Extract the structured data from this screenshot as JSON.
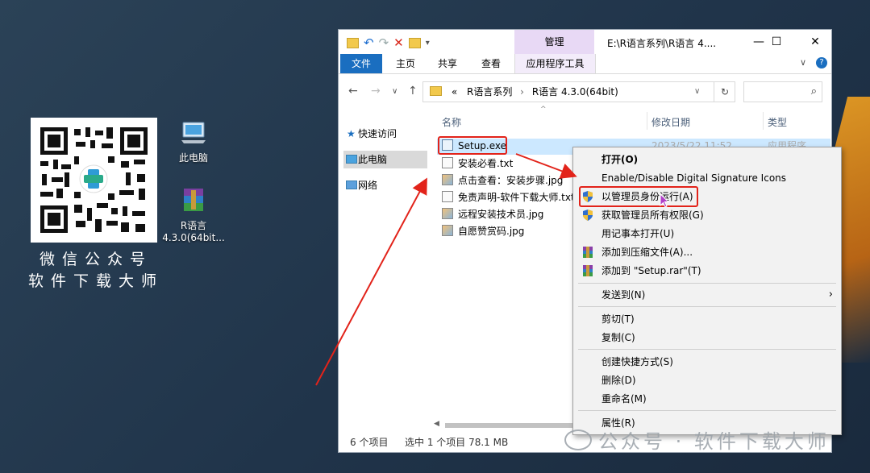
{
  "desktop": {
    "qr_caption_line1": "微信公众号",
    "qr_caption_line2": "软件下载大师",
    "icons": [
      {
        "label": "此电脑",
        "icon": "computer-icon"
      },
      {
        "label": "R语言\n4.3.0(64bit...",
        "icon": "winrar-archive-icon"
      }
    ]
  },
  "window": {
    "title": "E:\\R语言系列\\R语言 4....",
    "manage_tab": "管理",
    "ribbon_tabs": [
      "文件",
      "主页",
      "共享",
      "查看",
      "应用程序工具"
    ],
    "breadcrumb": {
      "prefix": "«",
      "parts": [
        "R语言系列",
        "R语言 4.3.0(64bit)"
      ]
    },
    "columns": [
      "名称",
      "修改日期",
      "类型"
    ],
    "nav_items": [
      "快速访问",
      "此电脑",
      "网络"
    ],
    "files": [
      {
        "name": "Setup.exe",
        "date": "2023/5/22 11:52",
        "type": "应用程序",
        "icon": "exe-icon"
      },
      {
        "name": "安装必看.txt",
        "icon": "txt-icon"
      },
      {
        "name": "点击查看：安装步骤.jpg",
        "icon": "jpg-icon"
      },
      {
        "name": "免责声明-软件下载大师.txt",
        "icon": "txt-icon"
      },
      {
        "name": "远程安装技术员.jpg",
        "icon": "jpg-icon"
      },
      {
        "name": "自愿赞赏码.jpg",
        "icon": "jpg-icon"
      }
    ],
    "status": {
      "count": "6 个项目",
      "selected": "选中 1 个项目  78.1 MB"
    }
  },
  "context_menu": {
    "items": [
      {
        "label": "打开(O)",
        "bold": true
      },
      {
        "label": "Enable/Disable Digital Signature Icons"
      },
      {
        "label": "以管理员身份运行(A)",
        "icon": "uac-shield-icon"
      },
      {
        "label": "获取管理员所有权限(G)",
        "icon": "uac-shield-icon"
      },
      {
        "label": "用记事本打开(U)"
      },
      {
        "label": "添加到压缩文件(A)...",
        "icon": "winrar-icon"
      },
      {
        "label": "添加到 \"Setup.rar\"(T)",
        "icon": "winrar-icon"
      },
      {
        "label": "发送到(N)",
        "submenu": true
      },
      {
        "label": "剪切(T)"
      },
      {
        "label": "复制(C)"
      },
      {
        "label": "创建快捷方式(S)"
      },
      {
        "label": "删除(D)"
      },
      {
        "label": "重命名(M)"
      },
      {
        "label": "属性(R)"
      }
    ]
  },
  "watermark": "公众号 · 软件下载大师",
  "colors": {
    "accent_blue": "#1a6ec0",
    "selection": "#cce8ff",
    "manage_purple": "#e8d9f5",
    "highlight_red": "#e2231a"
  }
}
